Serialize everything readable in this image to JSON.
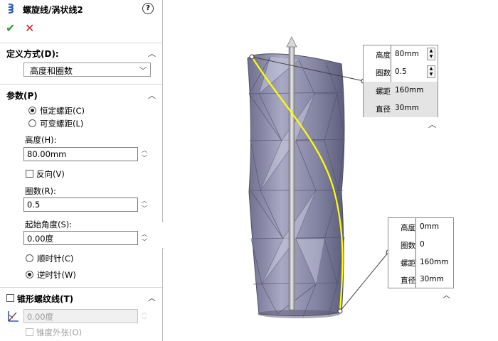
{
  "window": {
    "title": "螺旋线/涡状线2",
    "help": "?"
  },
  "actions": {
    "ok": "✔",
    "cancel": "✕"
  },
  "definition": {
    "header": "定义方式(D):",
    "selected": "高度和圈数"
  },
  "params": {
    "header": "参数(P)",
    "constant_pitch": "恒定螺距(C)",
    "variable_pitch": "可变螺距(L)",
    "height_label": "高度(H):",
    "height_value": "80.00mm",
    "reverse_label": "反向(V)",
    "revolutions_label": "圈数(R):",
    "revolutions_value": "0.5",
    "start_angle_label": "起始角度(S):",
    "start_angle_value": "0.00度",
    "clockwise": "顺时针(C)",
    "counter_clockwise": "逆时针(W)"
  },
  "taper": {
    "header": "锥形螺纹线(T)",
    "angle_value": "0.00度",
    "taper_outward": "锥度外张(O)"
  },
  "callout_top": {
    "rows": [
      {
        "key": "高度",
        "value": "80mm"
      },
      {
        "key": "圈数",
        "value": "0.5"
      },
      {
        "key": "螺距",
        "value": "160mm"
      },
      {
        "key": "直径",
        "value": "30mm"
      }
    ]
  },
  "callout_bottom": {
    "rows": [
      {
        "key": "高度",
        "value": "0mm"
      },
      {
        "key": "圈数",
        "value": "0"
      },
      {
        "key": "螺距",
        "value": "160mm"
      },
      {
        "key": "直径",
        "value": "30mm"
      }
    ]
  },
  "colors": {
    "helix": "#ffff00",
    "accept": "#2f9e2f",
    "cancel": "#d42020",
    "model": "#8e8ea8"
  }
}
